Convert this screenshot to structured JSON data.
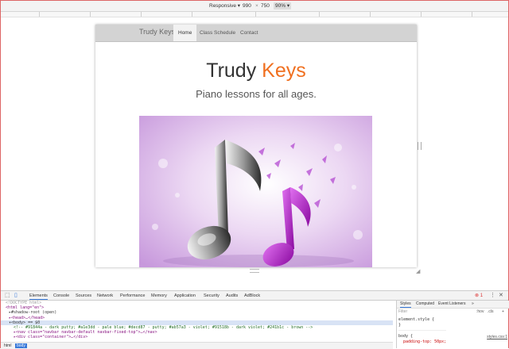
{
  "device_toolbar": {
    "mode": "Responsive",
    "width": "990",
    "times": "×",
    "height": "750",
    "zoom": "90%"
  },
  "page": {
    "navbar": {
      "brand": "Trudy Keys",
      "links": [
        "Home",
        "Class Schedule",
        "Contact"
      ]
    },
    "hero": {
      "title_part1": "Trudy ",
      "title_part2": "Keys",
      "subtitle": "Piano lessons for all ages."
    },
    "colors": {
      "accent": "#f07020",
      "note_dark": "#2a2a2a",
      "note_violet": "#b010c8",
      "bg_violet": "#d9b6e8"
    }
  },
  "devtools": {
    "tabs": [
      "Elements",
      "Console",
      "Sources",
      "Network",
      "Performance",
      "Memory",
      "Application",
      "Security",
      "Audits",
      "AdBlock"
    ],
    "error_count": "1",
    "elements": [
      "<!DOCTYPE html>",
      "<html lang=\"en\">",
      "▸#shadow-root (open)",
      "▸<head>…</head>",
      "▾<body> == $0",
      "<!-- #91844a - dark putty; #a1e3dd - pale blue; #decd87 - putty; #ab57a3 - violet; #91518b - dark violet; #241b1c - brown -->",
      "▸<nav class=\"navbar navbar-default navbar-fixed-top\">…</nav>",
      "▸<div class=\"container\">…</div>"
    ],
    "breadcrumbs": [
      "html",
      "body"
    ],
    "styles_tabs": [
      "Styles",
      "Computed",
      "Event Listeners"
    ],
    "styles_more": "»",
    "filter_placeholder": "Filter",
    "hov": ":hov",
    "cls": ".cls",
    "plus": "+",
    "rules": {
      "element_style": "element.style {",
      "close1": "}",
      "body_sel": "body {",
      "body_prop": "padding-top: 50px;",
      "source": "styles.css:1"
    }
  }
}
